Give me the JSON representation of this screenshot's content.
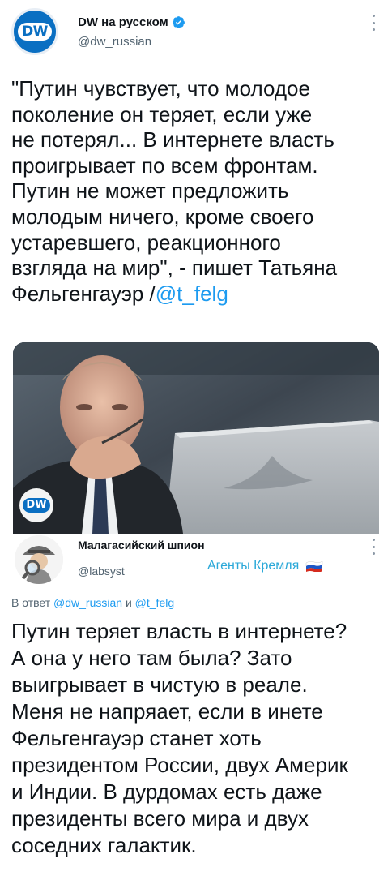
{
  "tweet": {
    "author": {
      "display_name": "DW на русском",
      "handle": "@dw_russian",
      "verified": true,
      "avatar_text": "DW"
    },
    "text_lines": [
      "\"Путин чувствует, что молодое",
      "поколение он теряет, если уже",
      "не потерял... В интернете власть",
      "проигрывает по всем фронтам.",
      "Путин не может предложить",
      "молодым ничего, кроме своего",
      "устаревшего, реакционного",
      "взгляда на мир\", - пишет Татьяна"
    ],
    "text_last_prefix": "Фельгенгауэр /",
    "text_last_mention": "@t_felg",
    "photo": {
      "description_icon": "photo-man-at-laptop",
      "watermark": "DW"
    }
  },
  "reply": {
    "author": {
      "display_name": "Малагасийский шпион",
      "handle": "@labsyst",
      "label": "Агенты Кремля",
      "label_icon": "russia-flag-icon"
    },
    "replying_to_prefix": "В ответ",
    "replying_to_mention_1": "@dw_russian",
    "replying_to_and": "и",
    "replying_to_mention_2": "@t_felg",
    "text": "Путин теряет власть в интернете?\nА она у него там была? Зато\nвыигрывает в чистую в реале.\nМеня не напряает, если в инете\nФельгенгауэр станет хоть\nпрезидентом России, двух Америк\nи Индии. В дурдомах есть даже\nпрезиденты всего мира и двух\nсоседних галактик."
  },
  "colors": {
    "accent": "#1d9bf0",
    "dw_blue": "#0a6fc2",
    "secondary_text": "#536471",
    "label_text": "#2aa8d8"
  }
}
